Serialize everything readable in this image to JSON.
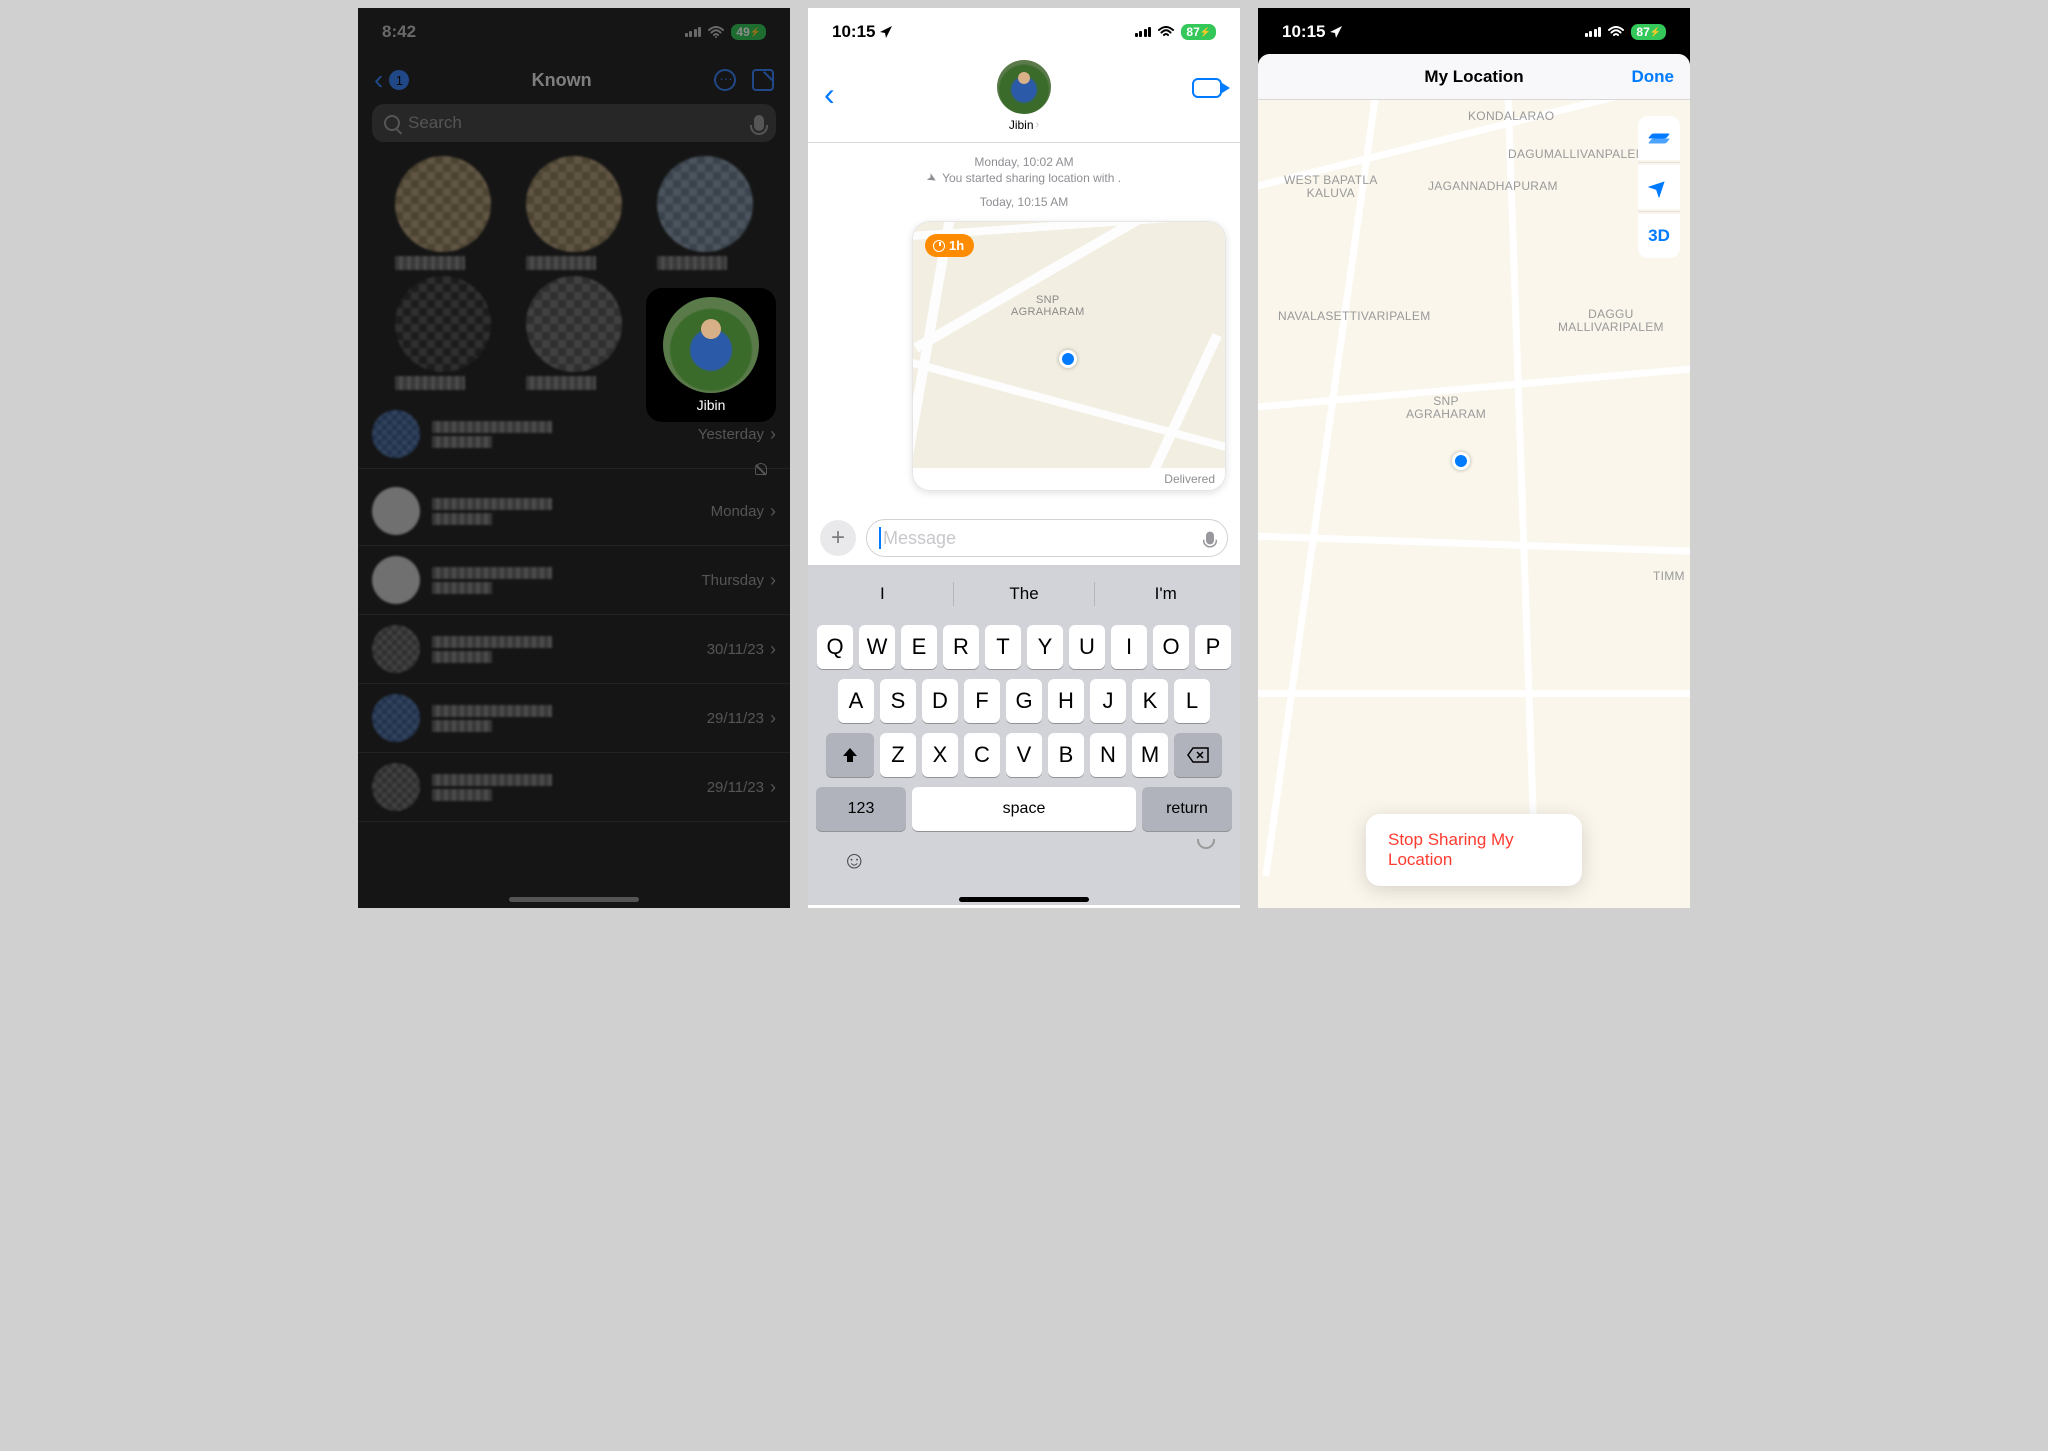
{
  "phone1": {
    "status": {
      "time": "8:42",
      "battery": "49"
    },
    "nav": {
      "badge": "1",
      "title": "Known"
    },
    "search": {
      "placeholder": "Search"
    },
    "highlight": {
      "name": "Jibin"
    },
    "rows": [
      {
        "date": "Yesterday",
        "muted": true
      },
      {
        "date": "Monday"
      },
      {
        "date": "Thursday"
      },
      {
        "date": "30/11/23"
      },
      {
        "date": "29/11/23"
      },
      {
        "date": "29/11/23"
      }
    ]
  },
  "phone2": {
    "status": {
      "time": "10:15",
      "battery": "87"
    },
    "header": {
      "name": "Jibin"
    },
    "timeline": {
      "line1": "Monday, 10:02 AM",
      "line2": "You started sharing location with .",
      "line3": "Today, 10:15 AM"
    },
    "bubble": {
      "badge": "1h",
      "area": "SNP\nAGRAHARAM",
      "delivered": "Delivered"
    },
    "input": {
      "placeholder": "Message"
    },
    "keyboard": {
      "suggestions": [
        "I",
        "The",
        "I'm"
      ],
      "row1": [
        "Q",
        "W",
        "E",
        "R",
        "T",
        "Y",
        "U",
        "I",
        "O",
        "P"
      ],
      "row2": [
        "A",
        "S",
        "D",
        "F",
        "G",
        "H",
        "J",
        "K",
        "L"
      ],
      "row3": [
        "Z",
        "X",
        "C",
        "V",
        "B",
        "N",
        "M"
      ],
      "numKey": "123",
      "space": "space",
      "return": "return"
    }
  },
  "phone3": {
    "status": {
      "time": "10:15",
      "battery": "87"
    },
    "header": {
      "title": "My Location",
      "done": "Done"
    },
    "labels": {
      "l1": "KONDALARAO",
      "l2": "DAGUMALLIVANPALEM",
      "l3": "WEST BAPATLA\nKALUVA",
      "l4": "JAGANNADHAPURAM",
      "l5": "NAVALASETTIVARIPALEM",
      "l6": "DAGGU\nMALLIVARIPALEM",
      "l7": "SNP\nAGRAHARAM",
      "l8": "TIMM",
      "threeD": "3D"
    },
    "stop": "Stop Sharing My Location"
  }
}
